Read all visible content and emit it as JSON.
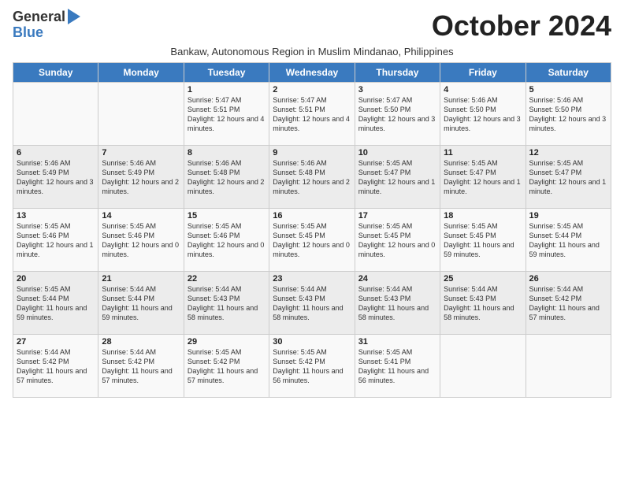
{
  "logo": {
    "general": "General",
    "blue": "Blue"
  },
  "title": "October 2024",
  "subtitle": "Bankaw, Autonomous Region in Muslim Mindanao, Philippines",
  "days_of_week": [
    "Sunday",
    "Monday",
    "Tuesday",
    "Wednesday",
    "Thursday",
    "Friday",
    "Saturday"
  ],
  "weeks": [
    [
      {
        "day": "",
        "content": ""
      },
      {
        "day": "",
        "content": ""
      },
      {
        "day": "1",
        "content": "Sunrise: 5:47 AM\nSunset: 5:51 PM\nDaylight: 12 hours and 4 minutes."
      },
      {
        "day": "2",
        "content": "Sunrise: 5:47 AM\nSunset: 5:51 PM\nDaylight: 12 hours and 4 minutes."
      },
      {
        "day": "3",
        "content": "Sunrise: 5:47 AM\nSunset: 5:50 PM\nDaylight: 12 hours and 3 minutes."
      },
      {
        "day": "4",
        "content": "Sunrise: 5:46 AM\nSunset: 5:50 PM\nDaylight: 12 hours and 3 minutes."
      },
      {
        "day": "5",
        "content": "Sunrise: 5:46 AM\nSunset: 5:50 PM\nDaylight: 12 hours and 3 minutes."
      }
    ],
    [
      {
        "day": "6",
        "content": "Sunrise: 5:46 AM\nSunset: 5:49 PM\nDaylight: 12 hours and 3 minutes."
      },
      {
        "day": "7",
        "content": "Sunrise: 5:46 AM\nSunset: 5:49 PM\nDaylight: 12 hours and 2 minutes."
      },
      {
        "day": "8",
        "content": "Sunrise: 5:46 AM\nSunset: 5:48 PM\nDaylight: 12 hours and 2 minutes."
      },
      {
        "day": "9",
        "content": "Sunrise: 5:46 AM\nSunset: 5:48 PM\nDaylight: 12 hours and 2 minutes."
      },
      {
        "day": "10",
        "content": "Sunrise: 5:45 AM\nSunset: 5:47 PM\nDaylight: 12 hours and 1 minute."
      },
      {
        "day": "11",
        "content": "Sunrise: 5:45 AM\nSunset: 5:47 PM\nDaylight: 12 hours and 1 minute."
      },
      {
        "day": "12",
        "content": "Sunrise: 5:45 AM\nSunset: 5:47 PM\nDaylight: 12 hours and 1 minute."
      }
    ],
    [
      {
        "day": "13",
        "content": "Sunrise: 5:45 AM\nSunset: 5:46 PM\nDaylight: 12 hours and 1 minute."
      },
      {
        "day": "14",
        "content": "Sunrise: 5:45 AM\nSunset: 5:46 PM\nDaylight: 12 hours and 0 minutes."
      },
      {
        "day": "15",
        "content": "Sunrise: 5:45 AM\nSunset: 5:46 PM\nDaylight: 12 hours and 0 minutes."
      },
      {
        "day": "16",
        "content": "Sunrise: 5:45 AM\nSunset: 5:45 PM\nDaylight: 12 hours and 0 minutes."
      },
      {
        "day": "17",
        "content": "Sunrise: 5:45 AM\nSunset: 5:45 PM\nDaylight: 12 hours and 0 minutes."
      },
      {
        "day": "18",
        "content": "Sunrise: 5:45 AM\nSunset: 5:45 PM\nDaylight: 11 hours and 59 minutes."
      },
      {
        "day": "19",
        "content": "Sunrise: 5:45 AM\nSunset: 5:44 PM\nDaylight: 11 hours and 59 minutes."
      }
    ],
    [
      {
        "day": "20",
        "content": "Sunrise: 5:45 AM\nSunset: 5:44 PM\nDaylight: 11 hours and 59 minutes."
      },
      {
        "day": "21",
        "content": "Sunrise: 5:44 AM\nSunset: 5:44 PM\nDaylight: 11 hours and 59 minutes."
      },
      {
        "day": "22",
        "content": "Sunrise: 5:44 AM\nSunset: 5:43 PM\nDaylight: 11 hours and 58 minutes."
      },
      {
        "day": "23",
        "content": "Sunrise: 5:44 AM\nSunset: 5:43 PM\nDaylight: 11 hours and 58 minutes."
      },
      {
        "day": "24",
        "content": "Sunrise: 5:44 AM\nSunset: 5:43 PM\nDaylight: 11 hours and 58 minutes."
      },
      {
        "day": "25",
        "content": "Sunrise: 5:44 AM\nSunset: 5:43 PM\nDaylight: 11 hours and 58 minutes."
      },
      {
        "day": "26",
        "content": "Sunrise: 5:44 AM\nSunset: 5:42 PM\nDaylight: 11 hours and 57 minutes."
      }
    ],
    [
      {
        "day": "27",
        "content": "Sunrise: 5:44 AM\nSunset: 5:42 PM\nDaylight: 11 hours and 57 minutes."
      },
      {
        "day": "28",
        "content": "Sunrise: 5:44 AM\nSunset: 5:42 PM\nDaylight: 11 hours and 57 minutes."
      },
      {
        "day": "29",
        "content": "Sunrise: 5:45 AM\nSunset: 5:42 PM\nDaylight: 11 hours and 57 minutes."
      },
      {
        "day": "30",
        "content": "Sunrise: 5:45 AM\nSunset: 5:42 PM\nDaylight: 11 hours and 56 minutes."
      },
      {
        "day": "31",
        "content": "Sunrise: 5:45 AM\nSunset: 5:41 PM\nDaylight: 11 hours and 56 minutes."
      },
      {
        "day": "",
        "content": ""
      },
      {
        "day": "",
        "content": ""
      }
    ]
  ]
}
